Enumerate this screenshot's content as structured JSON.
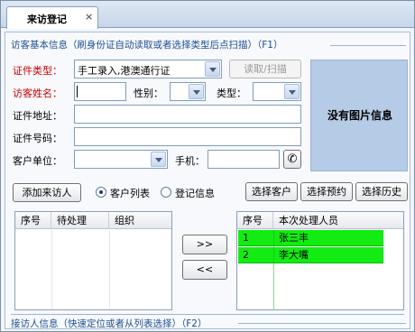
{
  "tab": {
    "label": "来访登记",
    "close": "×"
  },
  "visitor_section": {
    "title": "访客基本信息（刷身份证自动读取或者选择类型后点扫描）（F1）"
  },
  "form": {
    "id_type_label": "证件类型：",
    "id_type_value": "手工录入,港澳通行证",
    "read_scan_button": "读取/扫描",
    "name_label": "访客姓名：",
    "name_value": "",
    "gender_label": "性别：",
    "gender_value": "",
    "type_label": "类型：",
    "type_value": "",
    "address_label": "证件地址：",
    "address_value": "",
    "id_number_label": "证件号码：",
    "id_number_value": "",
    "company_label": "客户单位：",
    "company_value": "",
    "phone_label": "手机：",
    "phone_value": ""
  },
  "photo": {
    "text": "没有图片信息"
  },
  "actions": {
    "add_visitor": "添加来访人",
    "radio_customers": "客户列表",
    "radio_registration": "登记信息",
    "select_customer": "选择客户",
    "select_reservation": "选择预约",
    "select_history": "选择历史"
  },
  "left_grid": {
    "columns": [
      "序号",
      "待处理",
      "组织"
    ],
    "rows": []
  },
  "transfer": {
    "right": ">>",
    "left": "<<"
  },
  "right_grid": {
    "columns": [
      "序号",
      "本次处理人员"
    ],
    "rows": [
      {
        "index": "1",
        "name": "张三丰"
      },
      {
        "index": "2",
        "name": "李大嘴"
      }
    ],
    "row_color": "#12ec12"
  },
  "host_section": {
    "title": "接访人信息（快速定位或者从列表选择）（F2）"
  },
  "colors": {
    "accent": "#1d4e8f",
    "required": "#d00000",
    "photo_bg": "#b5cbe6"
  }
}
